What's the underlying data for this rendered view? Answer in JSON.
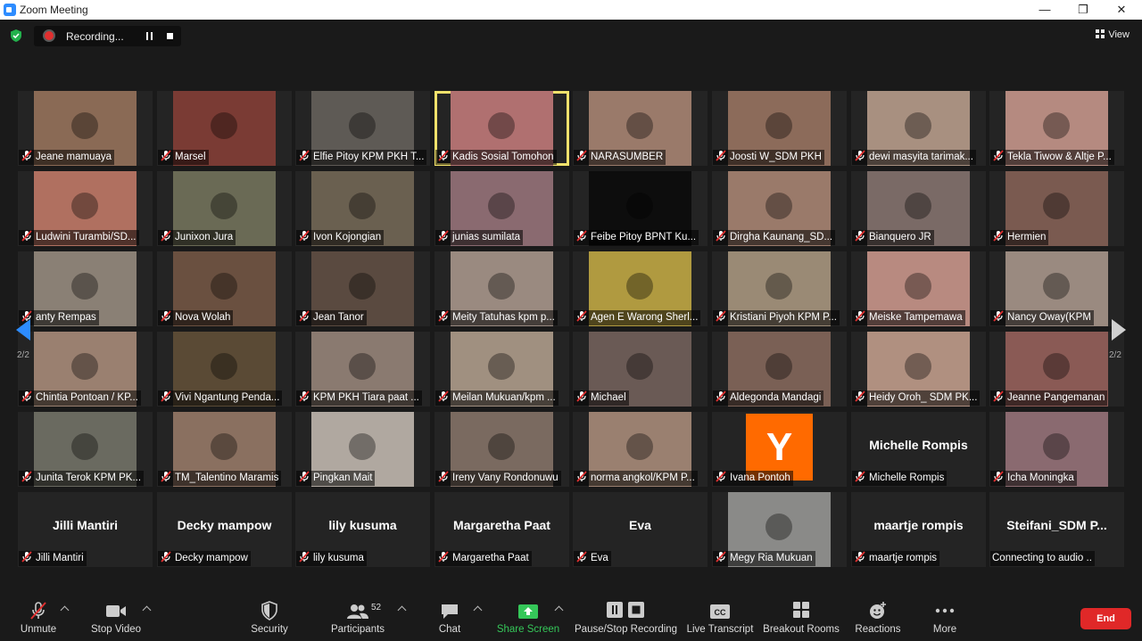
{
  "window": {
    "title": "Zoom Meeting"
  },
  "recording": {
    "label": "Recording..."
  },
  "view": {
    "label": "View"
  },
  "pagination": {
    "left": "2/2",
    "right": "2/2"
  },
  "participants": [
    {
      "name": "Jeane mamuaya",
      "type": "video",
      "color": "#8a6a55"
    },
    {
      "name": "Marsel",
      "type": "video",
      "color": "#7a3b34"
    },
    {
      "name": "Elfie Pitoy KPM PKH T...",
      "type": "video",
      "color": "#5e5a55"
    },
    {
      "name": "Kadis Sosial Tomohon",
      "type": "video",
      "color": "#b07070",
      "active": true
    },
    {
      "name": "NARASUMBER",
      "type": "video",
      "color": "#9a7a6a"
    },
    {
      "name": "Joosti W_SDM PKH",
      "type": "video",
      "color": "#8c6b5a"
    },
    {
      "name": "dewi masyita tarimak...",
      "type": "video",
      "color": "#a89080"
    },
    {
      "name": "Tekla Tiwow & Altje P...",
      "type": "video",
      "color": "#b58a80"
    },
    {
      "name": "Ludwini Turambi/SD...",
      "type": "video",
      "color": "#b07060"
    },
    {
      "name": "Junixon Jura",
      "type": "video",
      "color": "#6a6a55"
    },
    {
      "name": "Ivon Kojongian",
      "type": "video",
      "color": "#6a6050"
    },
    {
      "name": "junias sumilata",
      "type": "video",
      "color": "#8a6a70"
    },
    {
      "name": "Feibe Pitoy BPNT Ku...",
      "type": "video",
      "color": "#0d0d0d"
    },
    {
      "name": "Dirgha Kaunang_SD...",
      "type": "video",
      "color": "#9a7a6a"
    },
    {
      "name": "Bianquero JR",
      "type": "video",
      "color": "#7a6a66"
    },
    {
      "name": "Hermien",
      "type": "video",
      "color": "#7a5a50"
    },
    {
      "name": "anty Rempas",
      "type": "video",
      "color": "#8a8075"
    },
    {
      "name": "Nova Wolah",
      "type": "video",
      "color": "#6a5040"
    },
    {
      "name": "Jean Tanor",
      "type": "video",
      "color": "#5a4a40"
    },
    {
      "name": "Meity Tatuhas kpm p...",
      "type": "video",
      "color": "#9a8a80"
    },
    {
      "name": "Agen E Warong Sherl...",
      "type": "video",
      "color": "#b09a40"
    },
    {
      "name": "Kristiani Piyoh KPM P...",
      "type": "video",
      "color": "#9a8a75"
    },
    {
      "name": "Meiske Tampemawa",
      "type": "video",
      "color": "#b88a80"
    },
    {
      "name": "Nancy Oway(KPM",
      "type": "video",
      "color": "#9a8a80"
    },
    {
      "name": "Chintia Pontoan / KP...",
      "type": "video",
      "color": "#9a8070"
    },
    {
      "name": "Vivi Ngantung Penda...",
      "type": "video",
      "color": "#5a4a35"
    },
    {
      "name": "KPM PKH Tiara paat ...",
      "type": "video",
      "color": "#8a7a70"
    },
    {
      "name": "Meilan Mukuan/kpm ...",
      "type": "video",
      "color": "#a09080"
    },
    {
      "name": "Michael",
      "type": "video",
      "color": "#6a5a55"
    },
    {
      "name": "Aldegonda Mandagi",
      "type": "video",
      "color": "#7a6055"
    },
    {
      "name": "Heidy Oroh_ SDM PK...",
      "type": "video",
      "color": "#b09080"
    },
    {
      "name": "Jeanne Pangemanan",
      "type": "video",
      "color": "#8a5a55"
    },
    {
      "name": "Junita Terok KPM PK...",
      "type": "video",
      "color": "#6a6a60"
    },
    {
      "name": "TM_Talentino Maramis",
      "type": "video",
      "color": "#8a7060"
    },
    {
      "name": "Pingkan Mait",
      "type": "video",
      "color": "#b0a8a0"
    },
    {
      "name": "Ireny Vany Rondonuwu",
      "type": "video",
      "color": "#7a6a60"
    },
    {
      "name": "norma angkol/KPM P...",
      "type": "video",
      "color": "#9a8070"
    },
    {
      "name": "Ivana Pontoh",
      "type": "avatar",
      "initial": "Y"
    },
    {
      "name": "Michelle Rompis",
      "type": "name",
      "display": "Michelle Rompis"
    },
    {
      "name": "Icha Moningka",
      "type": "video",
      "color": "#8a6a70"
    },
    {
      "name": "Jilli Mantiri",
      "type": "name",
      "display": "Jilli Mantiri"
    },
    {
      "name": "Decky mampow",
      "type": "name",
      "display": "Decky mampow"
    },
    {
      "name": "lily kusuma",
      "type": "name",
      "display": "lily kusuma"
    },
    {
      "name": "Margaretha Paat",
      "type": "name",
      "display": "Margaretha Paat"
    },
    {
      "name": "Eva",
      "type": "name",
      "display": "Eva"
    },
    {
      "name": "Megy Ria Mukuan",
      "type": "video",
      "color": "#8a8a88"
    },
    {
      "name": "maartje rompis",
      "type": "name",
      "display": "maartje rompis"
    },
    {
      "name": "Connecting to audio ..",
      "type": "connecting",
      "display": "Steifani_SDM P..."
    }
  ],
  "toolbar": {
    "unmute": "Unmute",
    "stop_video": "Stop Video",
    "security": "Security",
    "participants": "Participants",
    "participants_count": "52",
    "chat": "Chat",
    "share_screen": "Share Screen",
    "pause_stop": "Pause/Stop Recording",
    "live_transcript": "Live Transcript",
    "breakout_rooms": "Breakout Rooms",
    "reactions": "Reactions",
    "more": "More",
    "end": "End",
    "share_color": "#35c759",
    "end_color": "#e02828"
  }
}
